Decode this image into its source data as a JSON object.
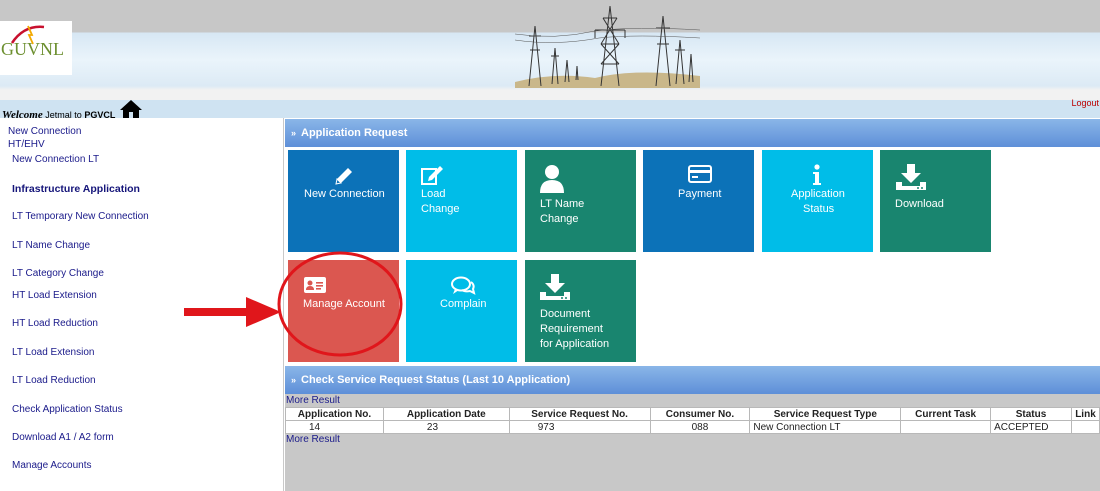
{
  "header": {
    "logo_text": "GUVNL",
    "welcome_prefix": "Welcome",
    "welcome_user": "Jetmal",
    "welcome_to": "to",
    "welcome_company": "PGVCL",
    "logout_label": "Logout"
  },
  "sidebar": {
    "items": [
      "New Connection",
      "HT/EHV",
      "New Connection LT",
      "Infrastructure Application",
      "LT Temporary New Connection",
      "LT Name Change",
      "LT Category Change",
      "HT Load Extension",
      "HT Load Reduction",
      "LT Load Extension",
      "LT Load Reduction",
      "Check Application Status",
      "Download A1 / A2 form",
      "Manage Accounts"
    ]
  },
  "application_request": {
    "title": "Application Request",
    "tiles": [
      {
        "label1": "New Connection",
        "label2": "",
        "label3": "",
        "icon": "pencil-icon",
        "color": "#0c72b8"
      },
      {
        "label1": "Load",
        "label2": "Change",
        "label3": "",
        "icon": "edit-icon",
        "color": "#00bde8"
      },
      {
        "label1": "LT Name",
        "label2": "Change",
        "label3": "",
        "icon": "user-icon",
        "color": "#19856f"
      },
      {
        "label1": "Payment",
        "label2": "",
        "label3": "",
        "icon": "credit-card-icon",
        "color": "#0c72b8"
      },
      {
        "label1": "Application",
        "label2": "Status",
        "label3": "",
        "icon": "info-icon",
        "color": "#00bde8"
      },
      {
        "label1": "Download",
        "label2": "",
        "label3": "",
        "icon": "download-icon",
        "color": "#19856f"
      },
      {
        "label1": "Manage Account",
        "label2": "",
        "label3": "",
        "icon": "id-card-icon",
        "color": "#db5750"
      },
      {
        "label1": "Complain",
        "label2": "",
        "label3": "",
        "icon": "chat-icon",
        "color": "#00bde8"
      },
      {
        "label1": "Document",
        "label2": "Requirement",
        "label3": "for Application",
        "icon": "download-icon",
        "color": "#19856f"
      }
    ]
  },
  "service_status": {
    "title": "Check Service Request Status (Last 10 Application)",
    "more_result": "More Result",
    "columns": [
      "Application No.",
      "Application Date",
      "Service Request No.",
      "Consumer No.",
      "Service Request Type",
      "Current Task",
      "Status",
      "Link"
    ],
    "rows": [
      [
        "14",
        "23",
        "973",
        "088",
        "New Connection LT",
        "",
        "ACCEPTED",
        ""
      ]
    ]
  },
  "colors": {
    "blue_tile": "#0c72b8",
    "cyan_tile": "#00bde8",
    "teal_tile": "#19856f",
    "red_tile": "#db5750",
    "annotation": "#e0161b"
  }
}
